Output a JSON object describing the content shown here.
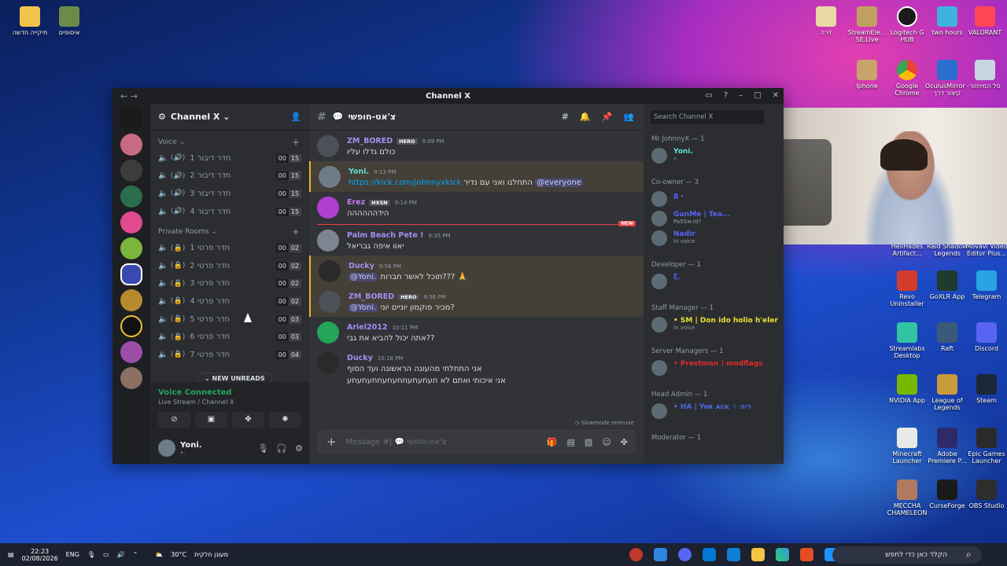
{
  "desktop": {
    "icons_left": [
      {
        "label": "תיקייה חדשה",
        "icon": "folder-icon",
        "color": "#f3c44b"
      },
      {
        "label": "איסופים",
        "icon": "book-icon",
        "color": "#6c8b4a"
      }
    ],
    "icons_top_right": [
      {
        "label": "זירה",
        "icon": "folder-icon",
        "color": "#e9d8a6"
      },
      {
        "label": "StreamEle... SE.Live",
        "icon": "crown-icon",
        "color": "#c0a060"
      },
      {
        "label": "Logitech G HUB",
        "icon": "logitech-icon",
        "color": "#1a1a1a"
      },
      {
        "label": "two hours",
        "icon": "monitor-icon",
        "color": "#3fb2e0"
      },
      {
        "label": "VALORANT",
        "icon": "valorant-icon",
        "color": "#ff4655"
      },
      {
        "label": "Iphone",
        "icon": "book-icon",
        "color": "#c9a36a"
      },
      {
        "label": "Google Chrome",
        "icon": "chrome-icon",
        "color": "#4285f4"
      },
      {
        "label": "OculusMirror - קיצור דרך",
        "icon": "mirror-icon",
        "color": "#2b6fce"
      },
      {
        "label": "סל המיחזור",
        "icon": "recycle-bin-icon",
        "color": "#c7d5e0"
      }
    ],
    "icons_right_col": [
      {
        "label": "HellHades Artifact...",
        "icon": "app-icon",
        "color": "#7b4ac9"
      },
      {
        "label": "Raid Shadow Legends",
        "icon": "app-icon",
        "color": "#8a2e2e"
      },
      {
        "label": "Movavi Video Editor Plus...",
        "icon": "app-icon",
        "color": "#2a86e6"
      },
      {
        "label": "Revo Uninstaller",
        "icon": "app-icon",
        "color": "#d33b2c"
      },
      {
        "label": "GoXLR App",
        "icon": "app-icon",
        "color": "#1e3b2e"
      },
      {
        "label": "Telegram",
        "icon": "telegram-icon",
        "color": "#2aa3e0"
      },
      {
        "label": "Streamlabs Desktop",
        "icon": "app-icon",
        "color": "#31c3a2"
      },
      {
        "label": "Raft",
        "icon": "app-icon",
        "color": "#3b5a7a"
      },
      {
        "label": "Discord",
        "icon": "discord-icon",
        "color": "#5865f2"
      },
      {
        "label": "NVIDIA App",
        "icon": "nvidia-icon",
        "color": "#76b900"
      },
      {
        "label": "League of Legends",
        "icon": "app-icon",
        "color": "#c89b3c"
      },
      {
        "label": "Steam",
        "icon": "steam-icon",
        "color": "#1b2838"
      },
      {
        "label": "Minecraft Launcher",
        "icon": "app-icon",
        "color": "#e9e9e9"
      },
      {
        "label": "Adobe Premiere P...",
        "icon": "premiere-icon",
        "color": "#2e2a6a"
      },
      {
        "label": "Epic Games Launcher",
        "icon": "epic-icon",
        "color": "#2a2a2a"
      },
      {
        "label": "MECCHA CHAMELEON",
        "icon": "app-icon",
        "color": "#b07a60"
      },
      {
        "label": "CurseForge",
        "icon": "app-icon",
        "color": "#1a1a1a"
      },
      {
        "label": "OBS Studio",
        "icon": "obs-icon",
        "color": "#2d2d2d"
      }
    ]
  },
  "window": {
    "title": "Channel X",
    "back": "←",
    "forward": "→"
  },
  "server": {
    "name": "Channel X ⌄"
  },
  "voice": {
    "category": "Voice ⌄",
    "channels": [
      {
        "name": "חדר דיבור 1",
        "a": "00",
        "b": "15"
      },
      {
        "name": "חדר דיבור 2",
        "a": "00",
        "b": "15"
      },
      {
        "name": "חדר דיבור 3",
        "a": "00",
        "b": "15"
      },
      {
        "name": "חדר דיבור 4",
        "a": "00",
        "b": "15"
      }
    ]
  },
  "private": {
    "category": "Private Rooms ⌄",
    "rooms": [
      {
        "name": "חדר פרטי 1",
        "a": "00",
        "b": "02"
      },
      {
        "name": "חדר פרטי 2",
        "a": "00",
        "b": "02"
      },
      {
        "name": "חדר פרטי 3",
        "a": "00",
        "b": "02"
      },
      {
        "name": "חדר פרטי 4",
        "a": "00",
        "b": "02"
      },
      {
        "name": "חדר פרטי 5",
        "a": "00",
        "b": "03"
      },
      {
        "name": "חדר פרטי 6",
        "a": "00",
        "b": "03"
      },
      {
        "name": "חדר פרטי 7",
        "a": "00",
        "b": "04"
      }
    ],
    "new_unreads": "NEW UNREADS"
  },
  "voice_conn": {
    "title": "Voice Connected",
    "sub": "Live Stream / Channel X"
  },
  "user": {
    "name": "Yoni.",
    "status": "•."
  },
  "channel": {
    "name": "צ'אט-חופשי"
  },
  "messages": [
    {
      "author": "ZM_BORED",
      "badge": "HERO",
      "time": "9:09 PM",
      "text": "כולם גדלו עליו",
      "color": "#a58cf0",
      "avatar": "#4e5058"
    },
    {
      "author": "Yoni.",
      "time": "9:13 PM",
      "link": "https://kick.com/johnnyxkick",
      "text": "התחלנו ואני עם נדיר",
      "mention": "@everyone",
      "color": "#5ee0d6",
      "avatar": "#6d7c86",
      "highlight": true
    },
    {
      "author": "Erez",
      "badge": "HXSN",
      "time": "9:14 PM",
      "text": "הידהההההה",
      "color": "#c27ae8",
      "avatar": "#b03fcf"
    },
    {
      "author": "Palm Beach Pete !",
      "time": "9:35 PM",
      "text": "יאוו איפה גבריאל",
      "color": "#a58cf0",
      "avatar": "#7e8590"
    },
    {
      "author": "Ducky",
      "time": "9:56 PM",
      "text": "תוכל לאשר חברות??? 🙏",
      "mention": "@Yoni.",
      "color": "#a58cf0",
      "avatar": "#2a2a2a",
      "highlight": true
    },
    {
      "author": "ZM_BORED",
      "badge": "HERO",
      "time": "9:56 PM",
      "text": "מכיר פוקמון יוניים יוני?",
      "mention": "@Yoni.",
      "color": "#a58cf0",
      "avatar": "#4e5058",
      "highlight": true
    },
    {
      "author": "Ariel2012",
      "time": "10:11 PM",
      "text": "אתה יכול להביא את גבי??",
      "color": "#a58cf0",
      "avatar": "#23a55a"
    },
    {
      "author": "Ducky",
      "time": "10:18 PM",
      "text": "אני התחלתי מהעונה הראשונה ועד הסוף",
      "text2": "אני איכותי ואתם לא חעחעחעחחעחעחחעחעחע",
      "color": "#a58cf0",
      "avatar": "#2a2a2a"
    }
  ],
  "new_label": "NEW",
  "slowmode": "Slowmode Immune",
  "composer": {
    "placeholder": "Message #| 💬 צ'אט-חופשי"
  },
  "search": {
    "placeholder": "Search Channel X"
  },
  "members": [
    {
      "role": "Mr JohnnyX — 1",
      "users": [
        {
          "name": "Yoni.",
          "status": "•.",
          "color": "#5ee0d6"
        }
      ]
    },
    {
      "role": "Co-owner — 3",
      "users": [
        {
          "name": "ß・",
          "status": "",
          "color": "#5865f2"
        },
        {
          "name": "GunMe | Tea...",
          "status": "Pa55w.rd?",
          "color": "#5865f2"
        },
        {
          "name": "Nadir",
          "status": "In voice",
          "color": "#5865f2"
        }
      ]
    },
    {
      "role": "Developer — 1",
      "users": [
        {
          "name": "ξ.",
          "status": "",
          "color": "#5865f2"
        }
      ]
    },
    {
      "role": "Staff Manager — 1",
      "users": [
        {
          "name": "• SM | Don ido holio h'eler",
          "status": "In voice",
          "color": "#e8e030"
        }
      ]
    },
    {
      "role": "Server Managers — 1",
      "users": [
        {
          "name": "• Prestman | modflags",
          "status": "",
          "color": "#e02a2a"
        }
      ]
    },
    {
      "role": "Head Admin — 1",
      "users": [
        {
          "name": "• HA | Yo⁠ʀ ⁠ᴀ⁠ᴄ⁠ᴋ ✧ ריה",
          "status": "",
          "color": "#4a6ae0"
        }
      ]
    },
    {
      "role": "Moderator — 1",
      "users": []
    }
  ],
  "taskbar": {
    "time": "22:23",
    "date": "02/08/2026",
    "lang": "ENG",
    "weather": "30°C",
    "weather_text": "מעונן חלקית",
    "search": "הקלד כאן כדי לחפש"
  }
}
